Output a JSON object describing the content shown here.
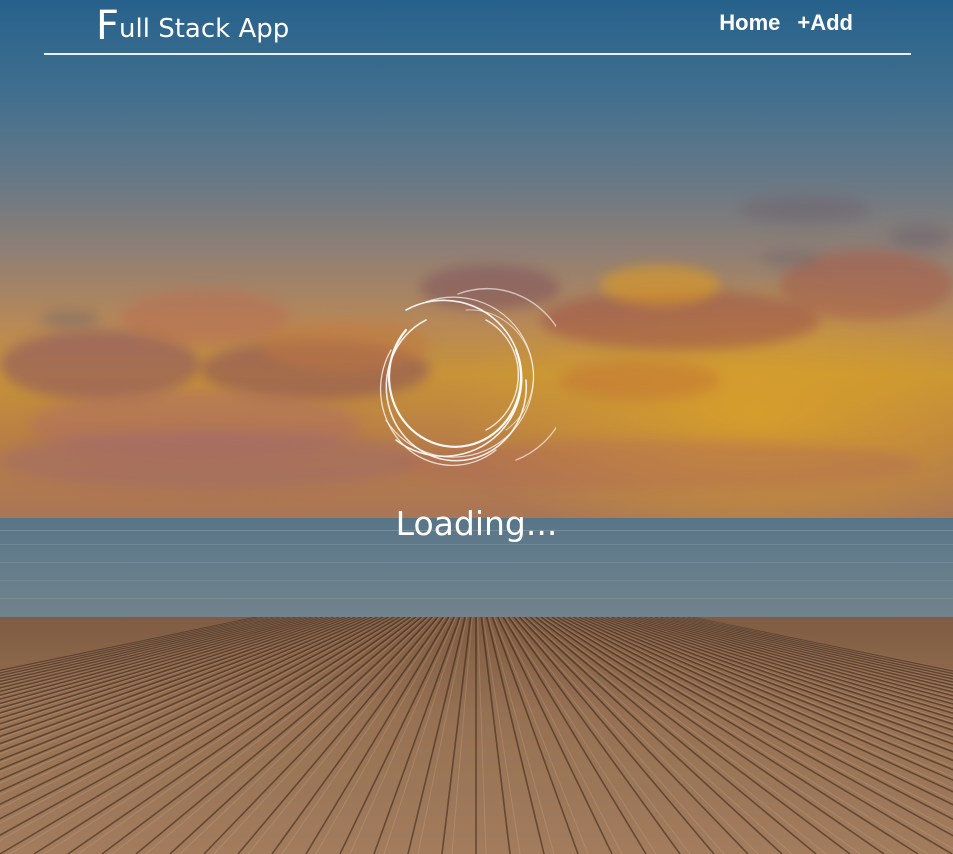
{
  "header": {
    "brand_first_letter": "F",
    "brand_rest": "ull Stack App"
  },
  "nav": {
    "home_label": "Home",
    "add_label": "+Add"
  },
  "loader": {
    "icon": "spinner-icon",
    "text": "Loading..."
  },
  "background": {
    "description_icon": "beach-deck-sunset-background",
    "accent_color": "#ffffff"
  }
}
